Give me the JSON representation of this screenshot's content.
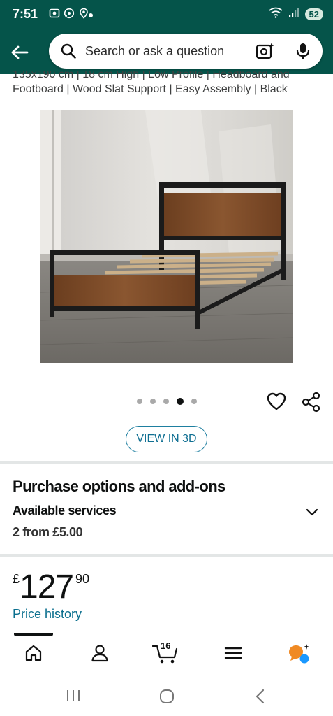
{
  "status_bar": {
    "time": "7:51",
    "battery": "52",
    "icons": [
      "screen-record-icon",
      "whatsapp-icon",
      "location-icon",
      "notification-dot",
      "wifi-icon",
      "signal-icon"
    ]
  },
  "search": {
    "placeholder": "Search or ask a question"
  },
  "product": {
    "title_line1": "135x190 cm | 18 cm High | Low Profile | Headboard and",
    "title_line2": "Footboard | Wood Slat Support | Easy Assembly | Black",
    "image_count": 5,
    "active_image": 4
  },
  "actions": {
    "view_3d": "VIEW IN 3D"
  },
  "purchase": {
    "heading": "Purchase options and add-ons",
    "services_label": "Available services",
    "services_count": "2 from £5.00"
  },
  "price": {
    "currency": "£",
    "whole": "127",
    "fraction": "90",
    "history_link": "Price history"
  },
  "bottom_nav": {
    "cart_count": "16",
    "items": [
      "home-icon",
      "account-icon",
      "cart-icon",
      "menu-icon",
      "rufus-icon"
    ]
  },
  "colors": {
    "header_bg": "#05544a",
    "link": "#0b6f8e",
    "rufus_orange": "#f08a24",
    "rufus_blue": "#1a98ff"
  }
}
